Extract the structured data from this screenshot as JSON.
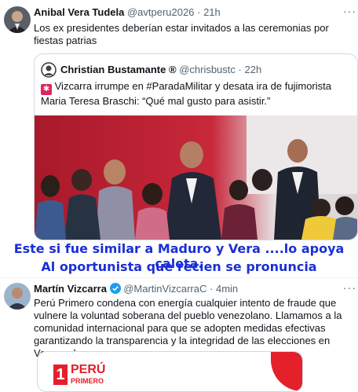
{
  "tweet1": {
    "name": "Anibal Vera Tudela",
    "handle": "@avtperu2026",
    "time": "21h",
    "text": "Los ex presidentes deberían estar invitados a las ceremonias por fiestas patrias",
    "more": "···"
  },
  "quote": {
    "name": "Christian Bustamante ®",
    "handle": "@chrisbustc",
    "time": "22h",
    "badge_icon": "alert-icon",
    "text": "Vizcarra irrumpe en #ParadaMilitar y desata ira de fujimorista Maria Teresa Braschi: “Qué mal gusto para asistir.”"
  },
  "caption": {
    "line1": "Este si fue similar a Maduro y Vera ....lo apoya caleta.",
    "line2": "Al oportunista que recien se pronuncia"
  },
  "tweet2": {
    "name": "Martín Vizcarra",
    "handle": "@MartinVizcarraC",
    "time": "4min",
    "text": "Perú Primero condena con energía  cualquier intento de fraude que vulnere la voluntad soberana del pueblo venezolano. Llamamos a la comunidad internacional para que se adopten medidas efectivas garantizando la transparencia y la integridad de las elecciones en Venezuela.",
    "more": "···",
    "card_logo_top": "PERÚ",
    "card_logo_bottom": "PRIMERO",
    "card_logo_number": "1"
  },
  "colors": {
    "verified": "#1d9bf0",
    "caption": "#1a2fd6",
    "logo_red": "#e4202a"
  }
}
